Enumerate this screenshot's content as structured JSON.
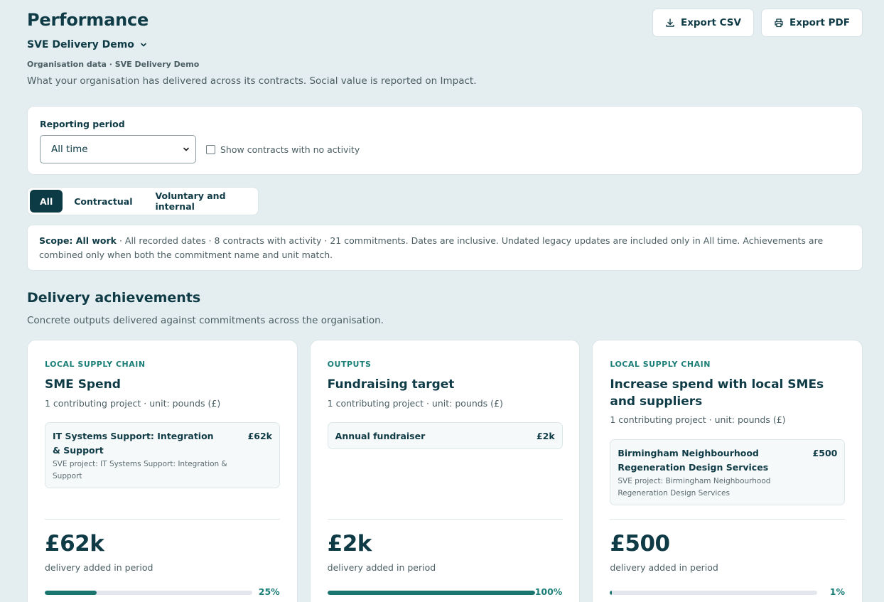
{
  "header": {
    "title": "Performance",
    "org_name": "SVE Delivery Demo",
    "org_meta": "Organisation data · SVE Delivery Demo",
    "description": "What your organisation has delivered across its contracts. Social value is reported on Impact.",
    "export_csv": "Export CSV",
    "export_pdf": "Export PDF"
  },
  "filters": {
    "label": "Reporting period",
    "period_value": "All time",
    "show_inactive_label": "Show contracts with no activity",
    "show_inactive_checked": false
  },
  "tabs": [
    {
      "label": "All",
      "active": true
    },
    {
      "label": "Contractual",
      "active": false
    },
    {
      "label": "Voluntary and internal",
      "active": false
    }
  ],
  "scope": {
    "label": "Scope: All work",
    "text": " · All recorded dates · 8 contracts with activity · 21 commitments. Dates are inclusive. Undated legacy updates are included only in All time. Achievements are combined only when both the commitment name and unit match."
  },
  "section": {
    "title": "Delivery achievements",
    "description": "Concrete outputs delivered against commitments across the organisation."
  },
  "cards": [
    {
      "category": "LOCAL SUPPLY CHAIN",
      "title": "SME Spend",
      "subtitle": "1 contributing project · unit: pounds (£)",
      "project": {
        "name": "IT Systems Support: Integration & Support",
        "value": "£62k",
        "desc": "SVE project: IT Systems Support: Integration & Support"
      },
      "value": "£62k",
      "value_label": "delivery added in period",
      "progress": 25,
      "progress_label": "25%"
    },
    {
      "category": "OUTPUTS",
      "title": "Fundraising target",
      "subtitle": "1 contributing project · unit: pounds (£)",
      "project": {
        "name": "Annual fundraiser",
        "value": "£2k",
        "desc": ""
      },
      "value": "£2k",
      "value_label": "delivery added in period",
      "progress": 100,
      "progress_label": "100%"
    },
    {
      "category": "LOCAL SUPPLY CHAIN",
      "title": "Increase spend with local SMEs and suppliers",
      "subtitle": "1 contributing project · unit: pounds (£)",
      "project": {
        "name": "Birmingham Neighbourhood Regeneration Design Services",
        "value": "£500",
        "desc": "SVE project: Birmingham Neighbourhood Regeneration Design Services"
      },
      "value": "£500",
      "value_label": "delivery added in period",
      "progress": 1,
      "progress_label": "1%"
    }
  ]
}
